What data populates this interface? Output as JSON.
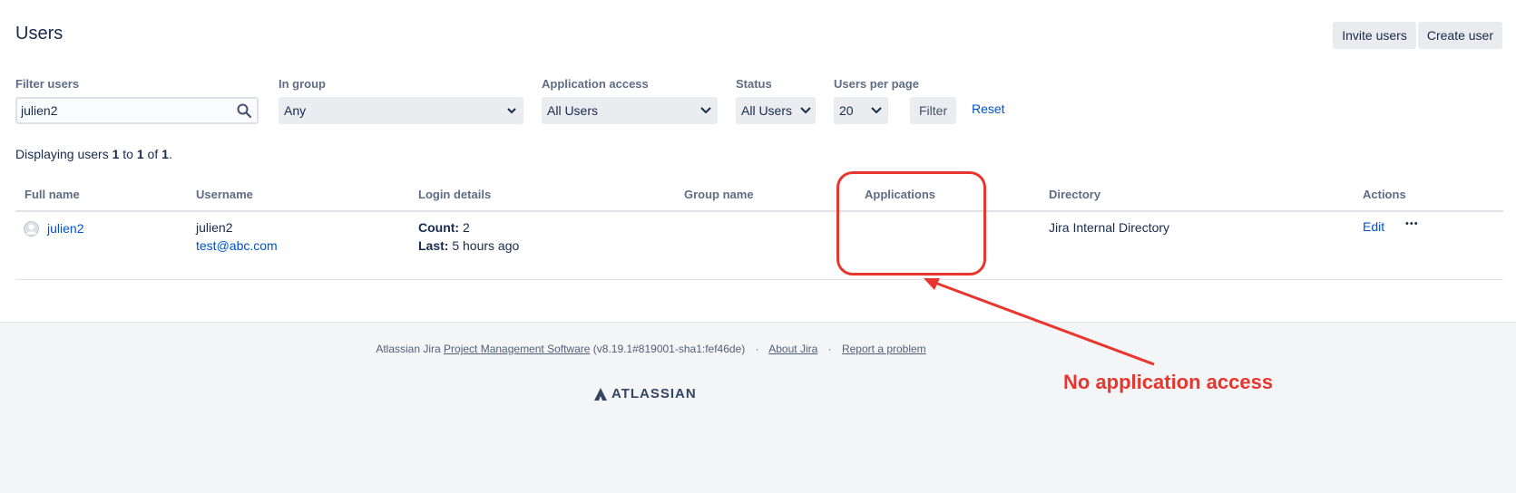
{
  "page": {
    "title": "Users"
  },
  "top_actions": {
    "invite": "Invite users",
    "create": "Create user"
  },
  "filters": {
    "filter_users_label": "Filter users",
    "filter_users_value": "julien2",
    "in_group_label": "In group",
    "in_group_value": "Any",
    "app_access_label": "Application access",
    "app_access_value": "All Users",
    "status_label": "Status",
    "status_value": "All Users",
    "per_page_label": "Users per page",
    "per_page_value": "20",
    "filter_button": "Filter",
    "reset_link": "Reset"
  },
  "summary": {
    "prefix": "Displaying users ",
    "from": "1",
    "to_word": " to ",
    "to": "1",
    "of_word": " of ",
    "total": "1",
    "suffix": "."
  },
  "table": {
    "headers": {
      "full_name": "Full name",
      "username": "Username",
      "login_details": "Login details",
      "group_name": "Group name",
      "applications": "Applications",
      "directory": "Directory",
      "actions": "Actions"
    },
    "rows": [
      {
        "full_name": "julien2",
        "username": "julien2",
        "email": "test@abc.com",
        "count_label": "Count:",
        "count_value": " 2",
        "last_label": "Last:",
        "last_value": " 5 hours ago",
        "directory": "Jira Internal Directory",
        "edit": "Edit",
        "more": "•••"
      }
    ]
  },
  "footer": {
    "prefix": "Atlassian Jira ",
    "pm_link": "Project Management Software",
    "version": " (v8.19.1#819001-sha1:fef46de)",
    "sep": "·",
    "about": "About Jira",
    "report": "Report a problem",
    "logo_text": "ATLASSIAN"
  },
  "annotation": {
    "text": "No application access",
    "color": "#e8362e"
  },
  "colors": {
    "link": "#0052cc",
    "text": "#172b4d",
    "muted": "#5e6c84",
    "footer_bg": "#f4f5f7"
  }
}
